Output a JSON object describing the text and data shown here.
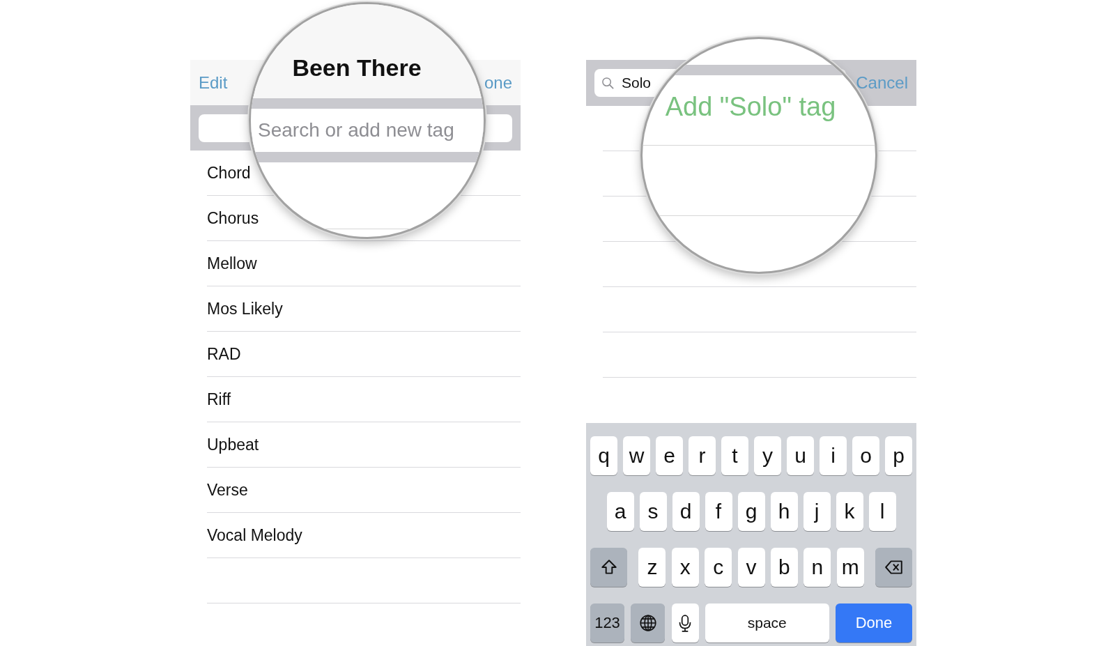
{
  "left_screen": {
    "nav": {
      "left_button": "Edit",
      "right_button": "one"
    },
    "magnifier": {
      "title": "Been There",
      "search_placeholder": "Search or add new tag"
    },
    "tags": [
      "Chord",
      "Chorus",
      "Mellow",
      "Mos Likely",
      "RAD",
      "Riff",
      "Upbeat",
      "Verse",
      "Vocal Melody"
    ]
  },
  "right_screen": {
    "search": {
      "value": "Solo"
    },
    "cancel_button": "Cancel",
    "magnifier": {
      "suggestion": "Add \"Solo\" tag"
    },
    "keyboard": {
      "rows": [
        {
          "keys": [
            {
              "kind": "letter",
              "label": "q"
            },
            {
              "kind": "letter",
              "label": "w"
            },
            {
              "kind": "letter",
              "label": "e"
            },
            {
              "kind": "letter",
              "label": "r"
            },
            {
              "kind": "letter",
              "label": "t"
            },
            {
              "kind": "letter",
              "label": "y"
            },
            {
              "kind": "letter",
              "label": "u"
            },
            {
              "kind": "letter",
              "label": "i"
            },
            {
              "kind": "letter",
              "label": "o"
            },
            {
              "kind": "letter",
              "label": "p"
            }
          ]
        },
        {
          "keys": [
            {
              "kind": "letter",
              "label": "a"
            },
            {
              "kind": "letter",
              "label": "s"
            },
            {
              "kind": "letter",
              "label": "d"
            },
            {
              "kind": "letter",
              "label": "f"
            },
            {
              "kind": "letter",
              "label": "g"
            },
            {
              "kind": "letter",
              "label": "h"
            },
            {
              "kind": "letter",
              "label": "j"
            },
            {
              "kind": "letter",
              "label": "k"
            },
            {
              "kind": "letter",
              "label": "l"
            }
          ]
        },
        {
          "keys": [
            {
              "kind": "shift"
            },
            {
              "kind": "letter",
              "label": "z"
            },
            {
              "kind": "letter",
              "label": "x"
            },
            {
              "kind": "letter",
              "label": "c"
            },
            {
              "kind": "letter",
              "label": "v"
            },
            {
              "kind": "letter",
              "label": "b"
            },
            {
              "kind": "letter",
              "label": "n"
            },
            {
              "kind": "letter",
              "label": "m"
            },
            {
              "kind": "delete"
            }
          ]
        },
        {
          "keys": [
            {
              "kind": "numbers",
              "label": "123"
            },
            {
              "kind": "globe"
            },
            {
              "kind": "mic"
            },
            {
              "kind": "space",
              "label": "space"
            },
            {
              "kind": "done",
              "label": "Done"
            }
          ]
        }
      ]
    }
  }
}
